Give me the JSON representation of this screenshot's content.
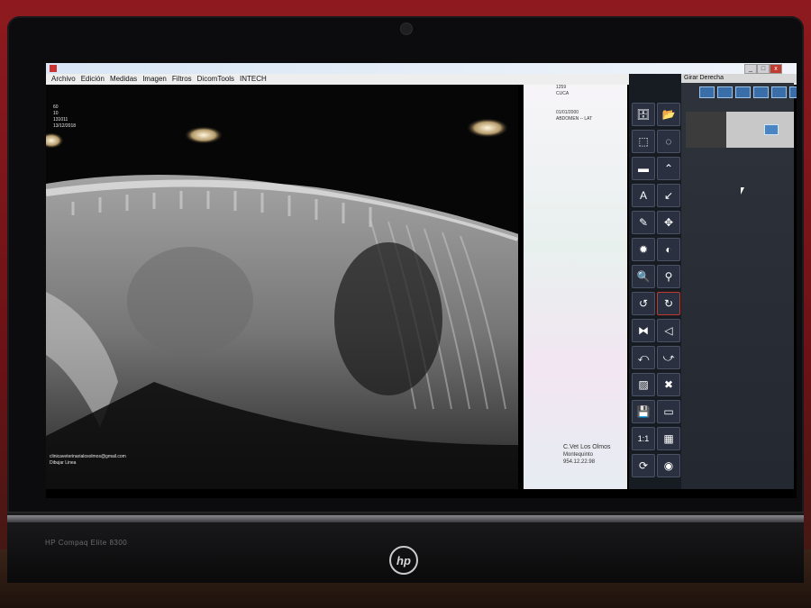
{
  "app": {
    "menu": [
      "Archivo",
      "Edición",
      "Medidas",
      "Imagen",
      "Filtros",
      "DicomTools",
      "INTECH"
    ],
    "window_buttons": [
      "_",
      "□",
      "x"
    ]
  },
  "overlay_top_left": [
    "60",
    "10",
    "131011",
    "13/12/2018"
  ],
  "overlay_bottom_left": [
    "clinicaveterinarialosolmos@gmail.com",
    "Dibujar Linea"
  ],
  "info_panel": {
    "top": [
      "1259",
      "CUCA"
    ],
    "mid": [
      "01/01/2000",
      "ABDOMEN -- LAT"
    ],
    "footer": {
      "clinic": "C.Vet Los Olmos",
      "town": "Montequinto",
      "phone": "954.12.22.98"
    }
  },
  "right_panel": {
    "header": "Girar Derecha"
  },
  "tools": [
    {
      "icon": "folder-db-icon"
    },
    {
      "icon": "open-folder-icon"
    },
    {
      "icon": "rect-select-icon"
    },
    {
      "icon": "ellipse-select-icon"
    },
    {
      "icon": "line-measure-icon"
    },
    {
      "icon": "angle-icon"
    },
    {
      "icon": "text-tool-icon"
    },
    {
      "icon": "arrow-tool-icon"
    },
    {
      "icon": "eraser-icon"
    },
    {
      "icon": "pan-icon"
    },
    {
      "icon": "brightness-icon"
    },
    {
      "icon": "contrast-icon"
    },
    {
      "icon": "zoom-icon"
    },
    {
      "icon": "lens-icon"
    },
    {
      "icon": "rotate-left-icon"
    },
    {
      "icon": "rotate-right-icon"
    },
    {
      "icon": "flip-horizontal-icon"
    },
    {
      "icon": "flip-vertical-icon"
    },
    {
      "icon": "undo-icon"
    },
    {
      "icon": "redo-icon"
    },
    {
      "icon": "invert-icon"
    },
    {
      "icon": "delete-icon"
    },
    {
      "icon": "save-icon"
    },
    {
      "icon": "export-icon"
    },
    {
      "icon": "zoom-1to1-icon",
      "label": "1:1"
    },
    {
      "icon": "grid-icon"
    },
    {
      "icon": "refresh-icon"
    },
    {
      "icon": "burn-disc-icon"
    }
  ],
  "device": {
    "model": "HP Compaq Elite 8300",
    "logo": "hp"
  },
  "colors": {
    "wall": "#8e1a1f",
    "toolbar_bg": "#171b22",
    "layout_button": "#3a6ea8",
    "selected_tool": "#c0392b"
  }
}
